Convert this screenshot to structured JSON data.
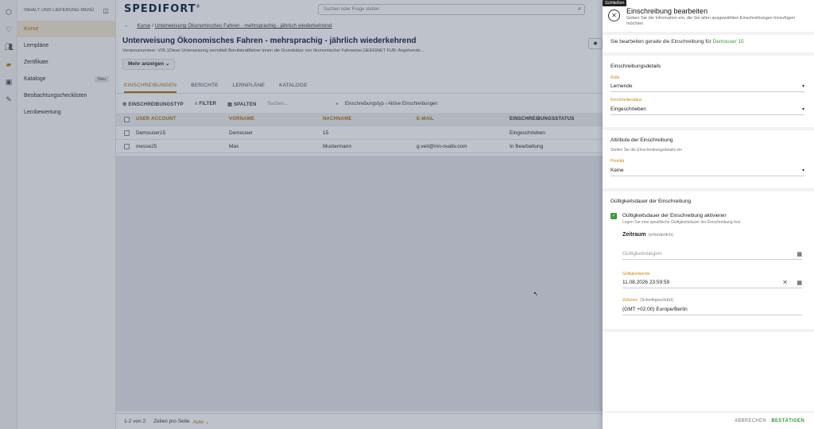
{
  "app": {
    "logo": "SPEDIFORT",
    "logo_mark": "®"
  },
  "rail": {
    "icons": [
      "box-icon",
      "heart-icon",
      "users-icon",
      "folder-icon",
      "image-icon",
      "tools-icon"
    ]
  },
  "sidenav": {
    "header": "INHALT UND LIEFERUNG-MENÜ",
    "items": [
      {
        "label": "Kurse",
        "active": true,
        "badge": ""
      },
      {
        "label": "Lernpläne",
        "badge": ""
      },
      {
        "label": "Zertifikate",
        "badge": ""
      },
      {
        "label": "Kataloge",
        "badge": "Neu"
      },
      {
        "label": "Beobachtungschecklisten",
        "badge": ""
      },
      {
        "label": "Lernbewertung",
        "badge": ""
      }
    ]
  },
  "search": {
    "placeholder": "Suchen oder Frage stellen"
  },
  "breadcrumb": {
    "root": "Kurse",
    "current": "Unterweisung Ökonomisches Fahren - mehrsprachig - jährlich wiederkehrend"
  },
  "course": {
    "title": "Unterweisung Ökonomisches Fahren - mehrsprachig - jährlich wiederkehrend",
    "version": "Versionsnummer: V25.1Diese Unterweisung vermittelt Berufskraftfahrer:innen die Grundsätze von ökonomischer Fahrweise.GEEIGNET FÜR: Angehende...",
    "more_label": "Mehr anzeigen"
  },
  "tabs": [
    "EINSCHREIBUNGEN",
    "BERICHTE",
    "LERNPLÄNE",
    "KATALOGE"
  ],
  "toolbar": {
    "type_btn": "EINSCHREIBUNGSTYP",
    "filter_btn": "FILTER",
    "columns_btn": "SPALTEN",
    "search_placeholder": "Suchen...",
    "chip_type": "Einschreibungstyp",
    "chip_sep": "›",
    "chip_value": "Aktive Einschreibungen"
  },
  "table": {
    "headers": [
      "USER ACCOUNT",
      "VORNAME",
      "NACHNAME",
      "E-MAIL",
      "EINSCHREIBUNGSSTATUS"
    ],
    "rows": [
      [
        "Demouser15",
        "Demouser",
        "15",
        "",
        "Eingeschrieben"
      ],
      [
        "messe25",
        "Max",
        "Mustermann",
        "g.veit@inn-ovativ.com",
        "In Bearbeitung"
      ]
    ]
  },
  "footer": {
    "range": "1-2 von 2",
    "rows_label": "Zeilen pro Seite",
    "rows_value": "Auto"
  },
  "panel": {
    "tooltip": "Schließen",
    "title": "Einschreibung bearbeiten",
    "subtitle": "Geben Sie die Information ein, die Sie allen ausgewählten Einschreibungen hinzufügen möchten",
    "editing_prefix": "Sie bearbeiten gerade die Einschreibung für",
    "editing_user": "Demouser 15",
    "details": {
      "title": "Einschreibungsdetails",
      "role_label": "Rolle",
      "role_value": "Lernende",
      "status_label": "Einschreibestatus",
      "status_value": "Eingeschrieben"
    },
    "attributes": {
      "title": "Attribute der Einschreibung",
      "hint": "Stellen Sie die Einschreibungsdetails ein",
      "priority_label": "Priorität",
      "priority_value": "Keine"
    },
    "validity": {
      "title": "Gültigkeitsdauer der Einschreibung",
      "checkbox_label": "Gültigkeitsdauer der Einschreibung aktivieren",
      "checkbox_hint": "Legen Sie eine spezifische Gültigkeitsdauer der Einschreibung fest",
      "period_label": "Zeitraum",
      "period_required": "(erforderlich)",
      "start_placeholder": "Gültigkeitsbeginn",
      "end_label": "Gültigkeitsende",
      "end_value": "11.08.2026 23:59:59",
      "tz_label": "Zeitzone",
      "tz_readonly": "(Schreibgeschützt)",
      "tz_value": "(GMT +02:00) Europe/Berlin"
    },
    "cancel_label": "ABBRECHEN",
    "confirm_label": "BESTÄTIGEN"
  }
}
